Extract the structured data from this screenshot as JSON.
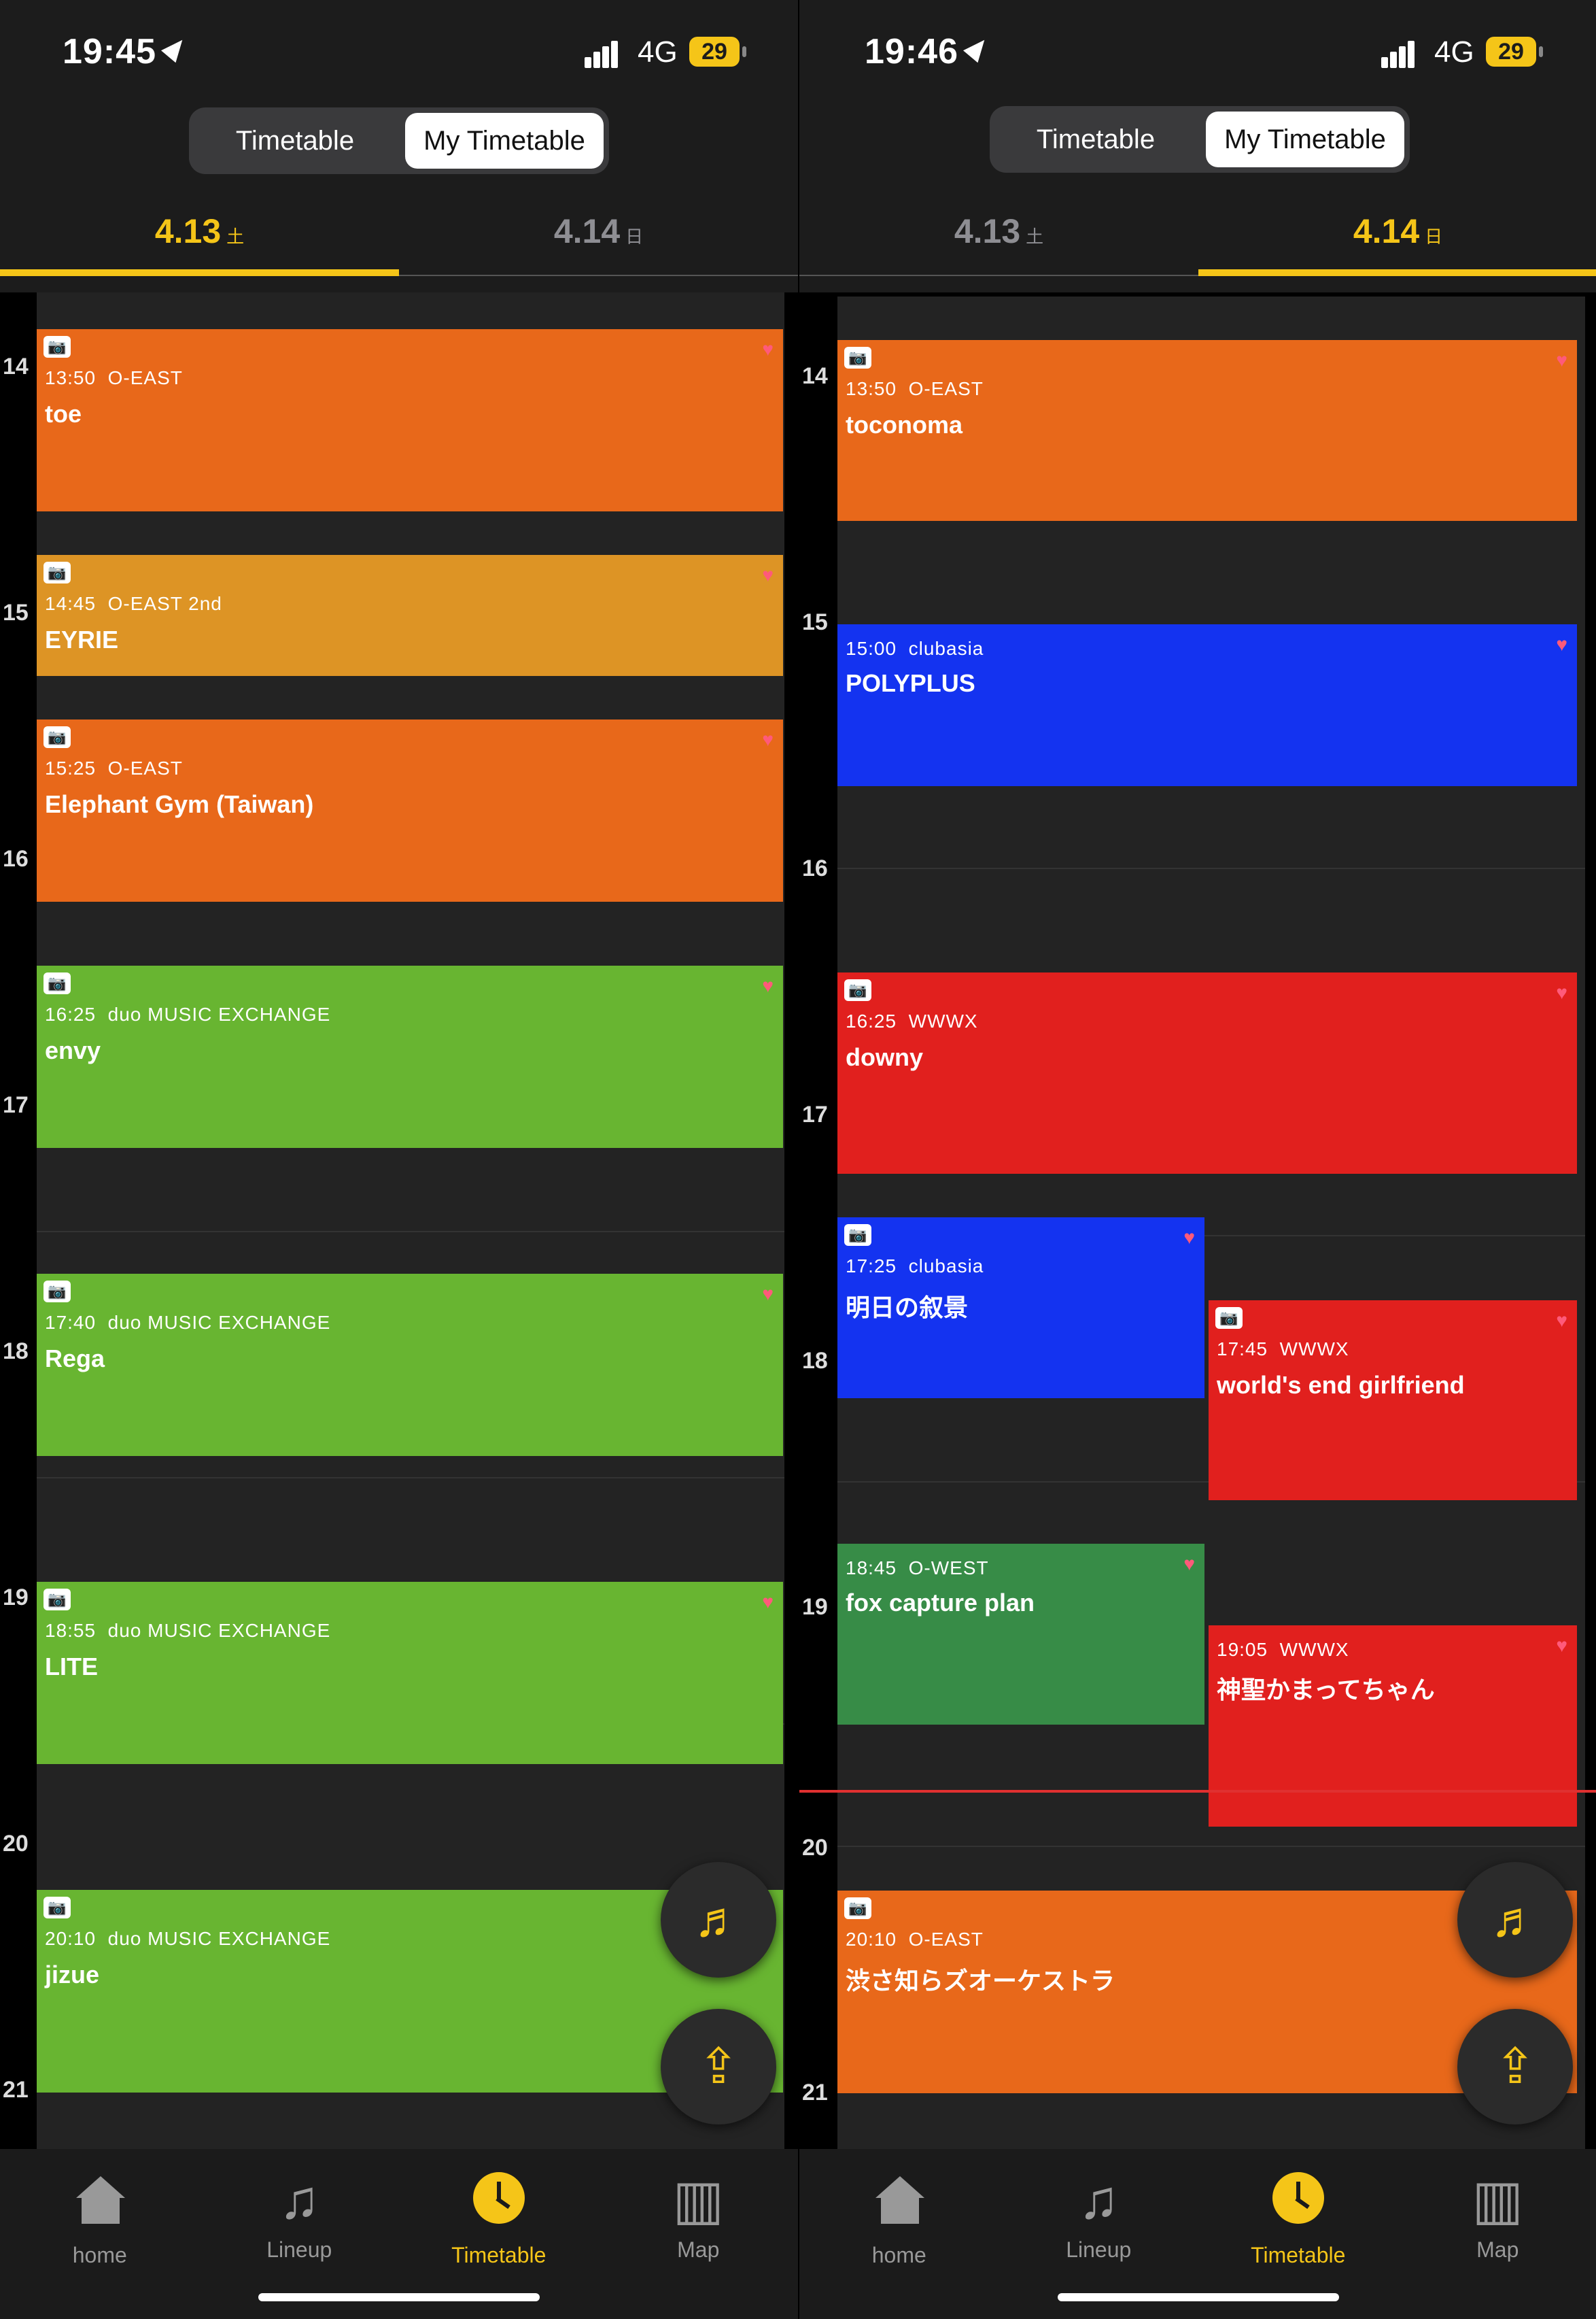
{
  "colors": {
    "accent": "#f5c518",
    "orange": "#e8681a",
    "amber": "#dd9425",
    "green": "#68b531",
    "dark_green": "#378c47",
    "red": "#e1201e",
    "blue": "#1433f0"
  },
  "screens": [
    {
      "status": {
        "time": "19:45",
        "network": "4G",
        "battery": "29"
      },
      "segment": {
        "tab1": "Timetable",
        "tab2": "My Timetable",
        "active": "My Timetable"
      },
      "dates": [
        {
          "date": "4.13",
          "weekday": "土",
          "active": true
        },
        {
          "date": "4.14",
          "weekday": "日",
          "active": false
        }
      ],
      "hours": [
        "14",
        "15",
        "16",
        "17",
        "18",
        "19",
        "20",
        "21"
      ],
      "events": [
        {
          "time": "13:50",
          "venue": "O-EAST",
          "artist": "toe",
          "color": "orange"
        },
        {
          "time": "14:45",
          "venue": "O-EAST 2nd",
          "artist": "EYRIE",
          "color": "amber"
        },
        {
          "time": "15:25",
          "venue": "O-EAST",
          "artist": "Elephant Gym (Taiwan)",
          "color": "orange"
        },
        {
          "time": "16:25",
          "venue": "duo MUSIC EXCHANGE",
          "artist": "envy",
          "color": "green"
        },
        {
          "time": "17:40",
          "venue": "duo MUSIC EXCHANGE",
          "artist": "Rega",
          "color": "green"
        },
        {
          "time": "18:55",
          "venue": "duo MUSIC EXCHANGE",
          "artist": "LITE",
          "color": "green"
        },
        {
          "time": "20:10",
          "venue": "duo MUSIC EXCHANGE",
          "artist": "jizue",
          "color": "green"
        }
      ]
    },
    {
      "status": {
        "time": "19:46",
        "network": "4G",
        "battery": "29"
      },
      "segment": {
        "tab1": "Timetable",
        "tab2": "My Timetable",
        "active": "My Timetable"
      },
      "dates": [
        {
          "date": "4.13",
          "weekday": "土",
          "active": false
        },
        {
          "date": "4.14",
          "weekday": "日",
          "active": true
        }
      ],
      "hours": [
        "14",
        "15",
        "16",
        "17",
        "18",
        "19",
        "20",
        "21"
      ],
      "events": [
        {
          "time": "13:50",
          "venue": "O-EAST",
          "artist": "toconoma",
          "color": "orange"
        },
        {
          "time": "15:00",
          "venue": "clubasia",
          "artist": "POLYPLUS",
          "color": "blue"
        },
        {
          "time": "16:25",
          "venue": "WWWX",
          "artist": "downy",
          "color": "red"
        },
        {
          "time": "17:25",
          "venue": "clubasia",
          "artist": "明日の叙景",
          "color": "blue"
        },
        {
          "time": "17:45",
          "venue": "WWWX",
          "artist": "world's end girlfriend",
          "color": "red"
        },
        {
          "time": "18:45",
          "venue": "O-WEST",
          "artist": "fox capture plan",
          "color": "dark_green"
        },
        {
          "time": "19:05",
          "venue": "WWWX",
          "artist": "神聖かまってちゃん",
          "color": "red"
        },
        {
          "time": "20:10",
          "venue": "O-EAST",
          "artist": "渋さ知らズオーケストラ",
          "color": "orange"
        }
      ]
    }
  ],
  "tabbar": [
    {
      "label": "home",
      "icon": "home-icon",
      "active": false
    },
    {
      "label": "Lineup",
      "icon": "music-note-icon",
      "active": false
    },
    {
      "label": "Timetable",
      "icon": "clock-icon",
      "active": true
    },
    {
      "label": "Map",
      "icon": "map-icon",
      "active": false
    }
  ]
}
